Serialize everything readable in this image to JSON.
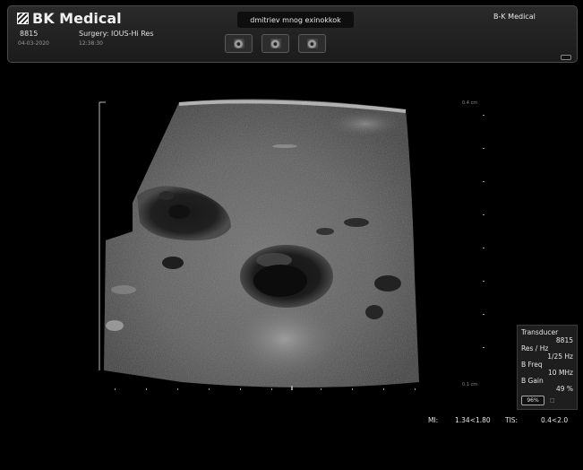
{
  "header": {
    "brand": "BK Medical",
    "transducer_id": "8815",
    "date": "04-03-2020",
    "exam": "Surgery: IOUS-Hi Res",
    "time": "12:38:30",
    "patient": "dmitriev mnog exinokkok",
    "company": "B-K Medical"
  },
  "image": {
    "depth_top": "0.4 cm",
    "depth_bottom": "0.1 cm"
  },
  "params": {
    "transducer_label": "Transducer",
    "transducer_value": "8815",
    "res_label": "Res / Hz",
    "res_value": "1/25 Hz",
    "freq_label": "B Freq",
    "freq_value": "10 MHz",
    "gain_label": "B Gain",
    "gain_value": "49 %",
    "gain_button": "96%"
  },
  "indices": {
    "mi_label": "MI:",
    "mi_value": "1.34<1.80",
    "tis_label": "TIS:",
    "tis_value": "0.4<2.0"
  }
}
